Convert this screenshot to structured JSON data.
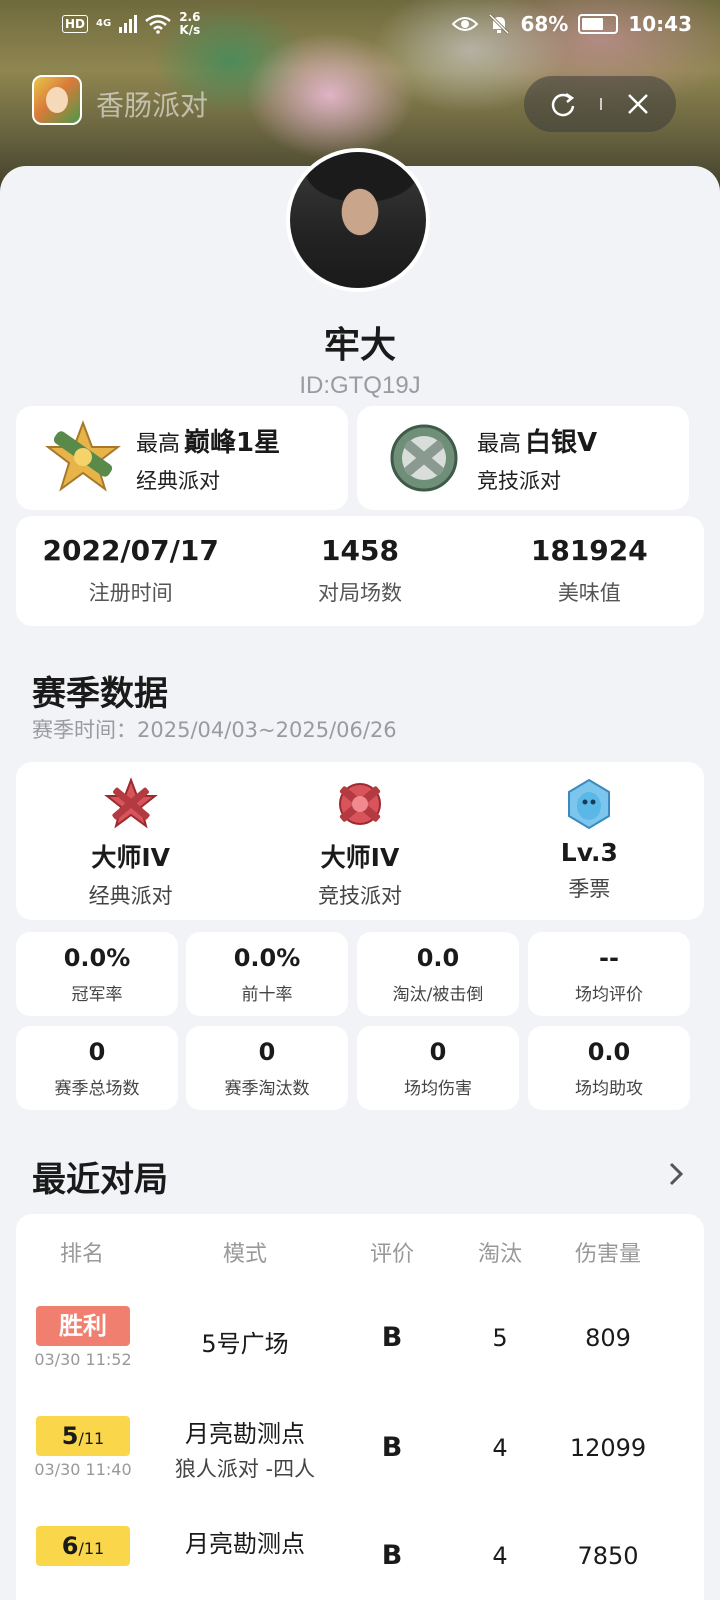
{
  "status_bar": {
    "hd": "HD",
    "network": "4G",
    "speed_value": "2.6",
    "speed_unit": "K/s",
    "battery": "68%",
    "time": "10:43"
  },
  "mini_app": {
    "name": "香肠派对",
    "refresh_icon": "refresh-icon",
    "close_icon": "close-icon"
  },
  "profile": {
    "nickname": "牢大",
    "id": "ID:GTQ19J",
    "ranks": [
      {
        "prefix": "最高",
        "rank": "巅峰1星",
        "mode": "经典派对"
      },
      {
        "prefix": "最高",
        "rank": "白银V",
        "mode": "竞技派对"
      }
    ],
    "stats": [
      {
        "value": "2022/07/17",
        "label": "注册时间"
      },
      {
        "value": "1458",
        "label": "对局场数"
      },
      {
        "value": "181924",
        "label": "美味值"
      }
    ]
  },
  "season": {
    "title": "赛季数据",
    "period": "赛季时间：2025/04/03~2025/06/26",
    "tiers": [
      {
        "name": "大师IV",
        "mode": "经典派对"
      },
      {
        "name": "大师IV",
        "mode": "竞技派对"
      },
      {
        "name": "Lv.3",
        "mode": "季票"
      }
    ],
    "stats": [
      {
        "value": "0.0%",
        "label": "冠军率"
      },
      {
        "value": "0.0%",
        "label": "前十率"
      },
      {
        "value": "0.0",
        "label": "淘汰/被击倒"
      },
      {
        "value": "--",
        "label": "场均评价"
      },
      {
        "value": "0",
        "label": "赛季总场数"
      },
      {
        "value": "0",
        "label": "赛季淘汰数"
      },
      {
        "value": "0",
        "label": "场均伤害"
      },
      {
        "value": "0.0",
        "label": "场均助攻"
      }
    ]
  },
  "recent": {
    "title": "最近对局",
    "headers": [
      "排名",
      "模式",
      "评价",
      "淘汰",
      "伤害量"
    ],
    "matches": [
      {
        "rank": "胜利",
        "rank_total": "",
        "time": "03/30 11:52",
        "mode": "5号广场",
        "sub_mode": "",
        "grade": "B",
        "kills": "5",
        "damage": "809"
      },
      {
        "rank": "5",
        "rank_total": "/11",
        "time": "03/30 11:40",
        "mode": "月亮勘测点",
        "sub_mode": "狼人派对 -四人",
        "grade": "B",
        "kills": "4",
        "damage": "12099"
      },
      {
        "rank": "6",
        "rank_total": "/11",
        "time": "",
        "mode": "月亮勘测点",
        "sub_mode": "",
        "grade": "B",
        "kills": "4",
        "damage": "7850"
      }
    ]
  },
  "colors": {
    "win_pill": "#f07f70",
    "placement_pill": "#f9d64a",
    "page_bg": "#f2f3f7"
  }
}
